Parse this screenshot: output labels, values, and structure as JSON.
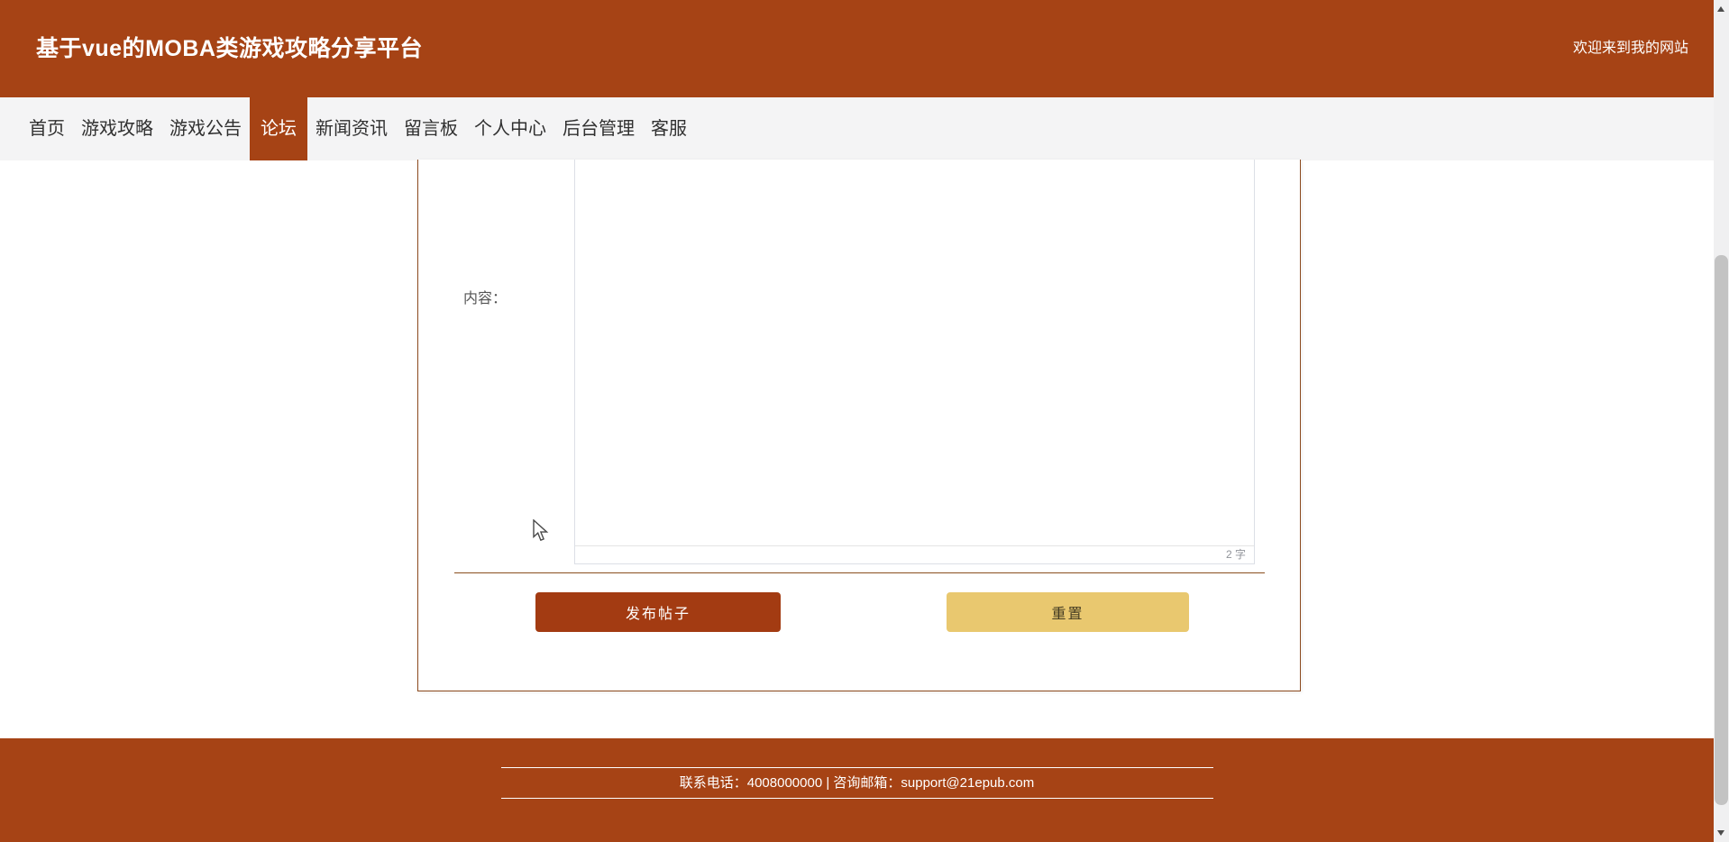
{
  "header": {
    "title": "基于vue的MOBA类游戏攻略分享平台",
    "welcome": "欢迎来到我的网站"
  },
  "nav": {
    "items": [
      {
        "label": "首页",
        "active": false
      },
      {
        "label": "游戏攻略",
        "active": false
      },
      {
        "label": "游戏公告",
        "active": false
      },
      {
        "label": "论坛",
        "active": true
      },
      {
        "label": "新闻资讯",
        "active": false
      },
      {
        "label": "留言板",
        "active": false
      },
      {
        "label": "个人中心",
        "active": false
      },
      {
        "label": "后台管理",
        "active": false
      },
      {
        "label": "客服",
        "active": false
      }
    ]
  },
  "form": {
    "content_label": "内容：",
    "textarea_value": "",
    "char_count": "2 字",
    "publish_label": "发布帖子",
    "reset_label": "重置"
  },
  "footer": {
    "contact": "联系电话：4008000000 | 咨询邮箱：support@21epub.com"
  },
  "colors": {
    "theme": "#a64315",
    "nav_bg": "#f4f4f5",
    "publish_button_bg": "#a33b12",
    "reset_button_bg": "#e9c86f",
    "panel_border": "#8c4a1e",
    "textarea_border": "#dcdfe6",
    "counter_text": "#909399"
  }
}
